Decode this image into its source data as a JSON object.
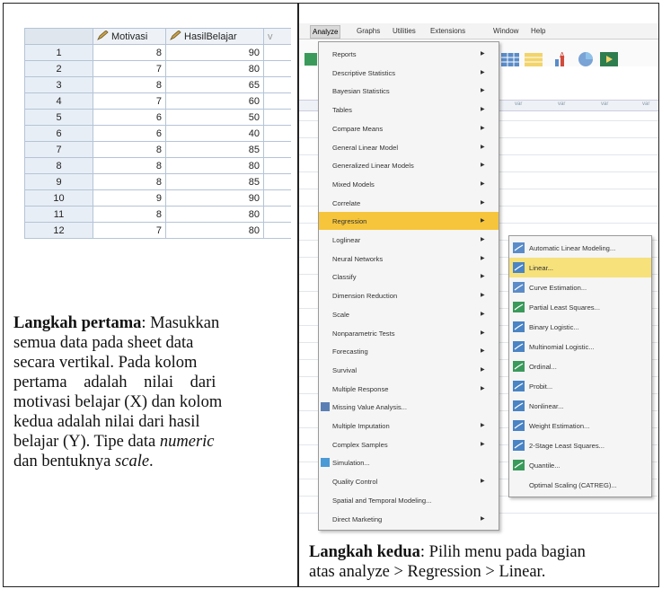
{
  "left": {
    "columns": [
      "Motivasi",
      "HasilBelajar",
      "v"
    ],
    "rows": [
      [
        "1",
        "8",
        "90"
      ],
      [
        "2",
        "7",
        "80"
      ],
      [
        "3",
        "8",
        "65"
      ],
      [
        "4",
        "7",
        "60"
      ],
      [
        "5",
        "6",
        "50"
      ],
      [
        "6",
        "6",
        "40"
      ],
      [
        "7",
        "8",
        "85"
      ],
      [
        "8",
        "8",
        "80"
      ],
      [
        "9",
        "8",
        "85"
      ],
      [
        "10",
        "9",
        "90"
      ],
      [
        "11",
        "8",
        "80"
      ],
      [
        "12",
        "7",
        "80"
      ]
    ],
    "caption": {
      "bold": "Langkah pertama",
      "line1_rest": ": Masukkan",
      "line2": "semua data pada sheet data",
      "line3": "secara vertikal. Pada kolom",
      "line4": "pertama adalah nilai dari",
      "line5": "motivasi belajar (X) dan kolom",
      "line6": "kedua adalah nilai dari hasil",
      "line7_pre": "belajar (Y). Tipe data ",
      "line7_em": "numeric",
      "line8_pre": "dan bentuknya ",
      "line8_em": "scale",
      "line8_post": "."
    }
  },
  "right": {
    "menubar": [
      "Analyze",
      "Graphs",
      "Utilities",
      "Extensions",
      "Window",
      "Help"
    ],
    "analyze_menu": [
      "Reports",
      "Descriptive Statistics",
      "Bayesian Statistics",
      "Tables",
      "Compare Means",
      "General Linear Model",
      "Generalized Linear Models",
      "Mixed Models",
      "Correlate",
      "Regression",
      "Loglinear",
      "Neural Networks",
      "Classify",
      "Dimension Reduction",
      "Scale",
      "Nonparametric Tests",
      "Forecasting",
      "Survival",
      "Multiple Response",
      "Missing Value Analysis...",
      "Multiple Imputation",
      "Complex Samples",
      "Simulation...",
      "Quality Control",
      "Spatial and Temporal Modeling...",
      "Direct Marketing"
    ],
    "regression_menu": [
      "Automatic Linear Modeling...",
      "Linear...",
      "Curve Estimation...",
      "Partial Least Squares...",
      "Binary Logistic...",
      "Multinomial Logistic...",
      "Ordinal...",
      "Probit...",
      "Nonlinear...",
      "Weight Estimation...",
      "2-Stage Least Squares...",
      "Quantile...",
      "Optimal Scaling (CATREG)..."
    ],
    "col_stub": "var",
    "caption": {
      "bold": "Langkah kedua",
      "line1_rest": ": Pilih menu pada bagian",
      "line2": "atas analyze > Regression > Linear."
    }
  },
  "colors": {
    "highlight": "#f6c53b",
    "submenu_highlight": "#f6e17a",
    "grid_border": "#b4c4d6",
    "rownum_bg": "#e8eef6"
  }
}
